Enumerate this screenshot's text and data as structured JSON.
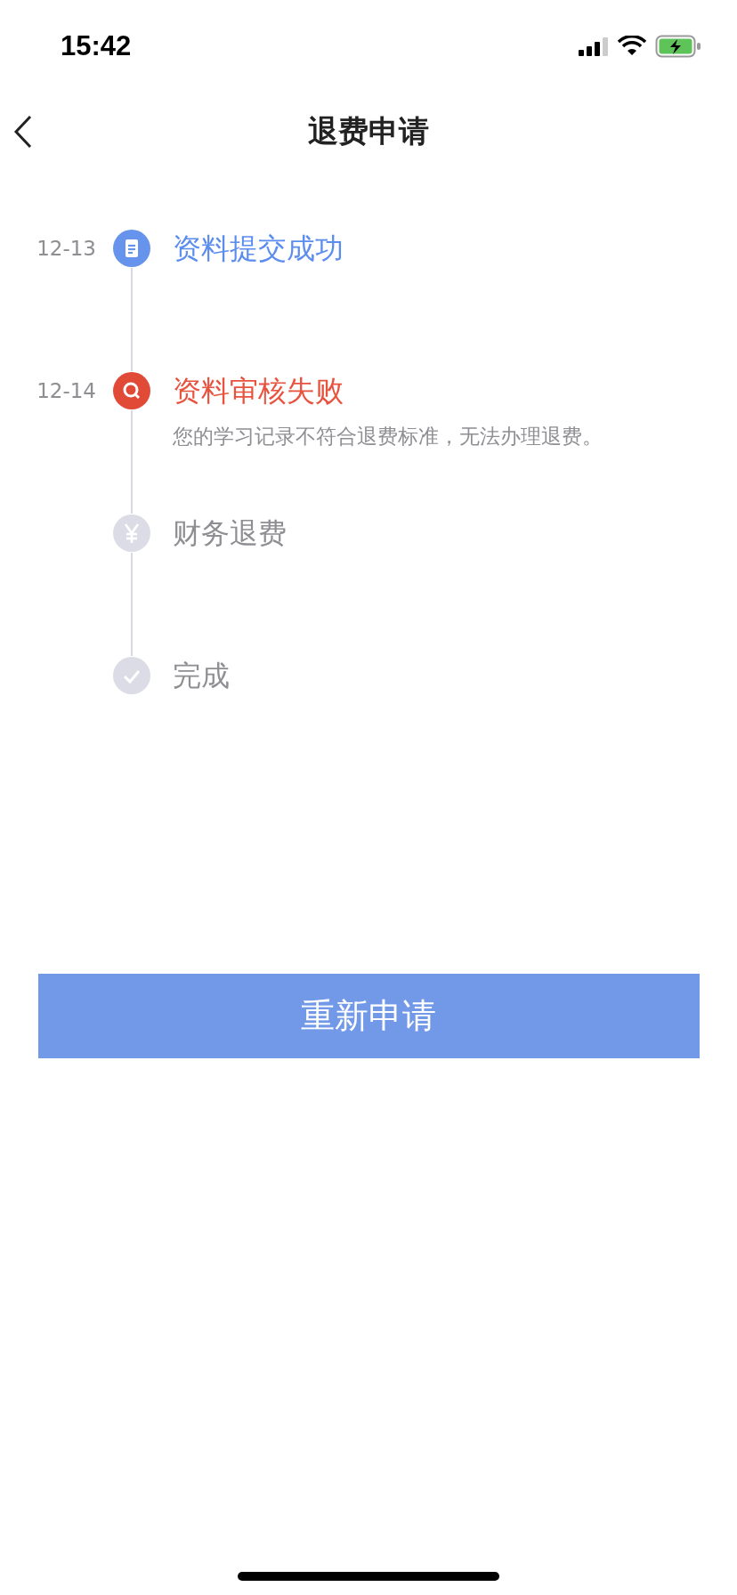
{
  "status_bar": {
    "time": "15:42"
  },
  "nav": {
    "title": "退费申请"
  },
  "steps": [
    {
      "date": "12-13",
      "title": "资料提交成功",
      "kind": "done"
    },
    {
      "date": "12-14",
      "title": "资料审核失败",
      "kind": "failed",
      "description": "您的学习记录不符合退费标准，无法办理退费。"
    },
    {
      "title": "财务退费",
      "kind": "pending"
    },
    {
      "title": "完成",
      "kind": "pending"
    }
  ],
  "button": {
    "label": "重新申请"
  }
}
